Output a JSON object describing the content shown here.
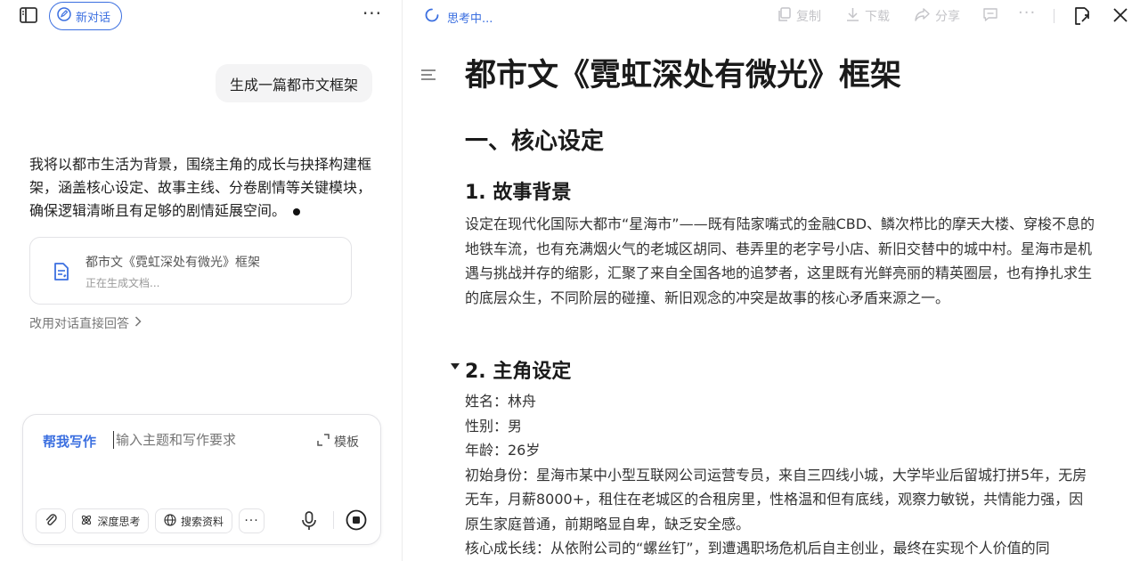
{
  "left_panel": {
    "new_chat_label": "新对话",
    "user_message": "生成一篇都市文框架",
    "assistant_reply": "我将以都市生活为背景，围绕主角的成长与抉择构建框架，涵盖核心设定、故事主线、分卷剧情等关键模块，确保逻辑清晰且有足够的剧情延展空间。",
    "doc_card": {
      "title": "都市文《霓虹深处有微光》框架",
      "status": "正在生成文档..."
    },
    "direct_answer_label": "改用对话直接回答",
    "composer": {
      "mode_label": "帮我写作",
      "placeholder": "输入主题和写作要求",
      "template_label": "模板",
      "deep_think_label": "深度思考",
      "search_label": "搜索资料"
    }
  },
  "right_panel": {
    "status": "思考中...",
    "toolbar": {
      "copy_label": "复制",
      "download_label": "下载",
      "share_label": "分享"
    },
    "document": {
      "title": "都市文《霓虹深处有微光》框架",
      "section_1": "一、核心设定",
      "subsection_1": "1. 故事背景",
      "background_text": "设定在现代化国际大都市“星海市”——既有陆家嘴式的金融CBD、鳞次栉比的摩天大楼、穿梭不息的地铁车流，也有充满烟火气的老城区胡同、巷弄里的老字号小店、新旧交替中的城中村。星海市是机遇与挑战并存的缩影，汇聚了来自全国各地的追梦者，这里既有光鲜亮丽的精英圈层，也有挣扎求生的底层众生，不同阶层的碰撞、新旧观念的冲突是故事的核心矛盾来源之一。",
      "subsection_2": "2. 主角设定",
      "fields": [
        "姓名：林舟",
        "性别：男",
        "年龄：26岁",
        "初始身份：星海市某中小型互联网公司运营专员，来自三四线小城，大学毕业后留城打拼5年，无房无车，月薪8000+，租住在老城区的合租房里，性格温和但有底线，观察力敏锐，共情能力强，因原生家庭普通，前期略显自卑，缺乏安全感。",
        "核心成长线：从依附公司的“螺丝钉”，到遭遇职场危机后自主创业，最终在实现个人价值的同"
      ]
    }
  },
  "colors": {
    "accent": "#3b6fe0",
    "muted_text": "#9a9a9a",
    "toolbar_disabled": "#c4c4c8"
  }
}
